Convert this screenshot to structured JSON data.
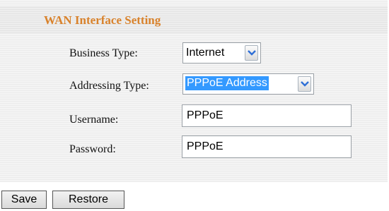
{
  "panel": {
    "title": "WAN Interface Setting"
  },
  "form": {
    "business_type": {
      "label": "Business Type:",
      "value": "Internet"
    },
    "addressing_type": {
      "label": "Addressing Type:",
      "value": "PPPoE Address"
    },
    "username": {
      "label": "Username:",
      "value": "PPPoE"
    },
    "password": {
      "label": "Password:",
      "value": "PPPoE"
    }
  },
  "buttons": {
    "save_label": "Save",
    "restore_label": "Restore"
  },
  "icons": {
    "dropdown": "chevron-down-icon"
  },
  "colors": {
    "title": "#d9822b",
    "selection": "#3399ff",
    "chevron": "#2f6fd6"
  }
}
